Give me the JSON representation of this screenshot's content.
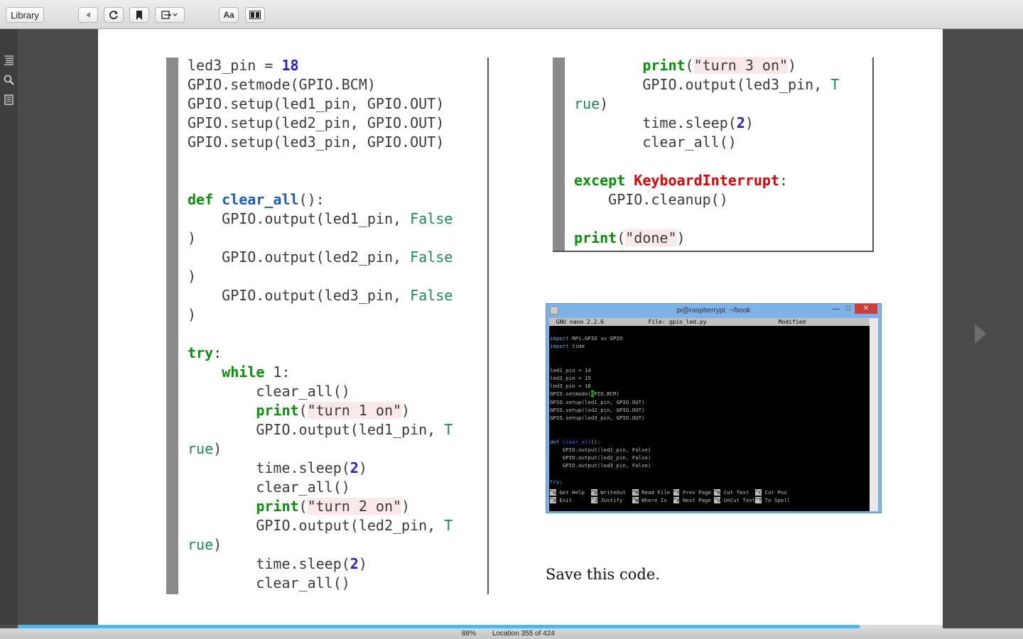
{
  "toolbar": {
    "library_label": "Library",
    "font_label": "Aa"
  },
  "left_code": [
    "led3_pin = 18",
    "GPIO.setmode(GPIO.BCM)",
    "GPIO.setup(led1_pin, GPIO.OUT)",
    "GPIO.setup(led2_pin, GPIO.OUT)",
    "GPIO.setup(led3_pin, GPIO.OUT)",
    "",
    "",
    "def clear_all():",
    "    GPIO.output(led1_pin, False",
    ")",
    "    GPIO.output(led2_pin, False",
    ")",
    "    GPIO.output(led3_pin, False",
    ")",
    "",
    "try:",
    "    while 1:",
    "        clear_all()",
    "        print(\"turn 1 on\")",
    "        GPIO.output(led1_pin, T",
    "rue)",
    "        time.sleep(2)",
    "        clear_all()",
    "        print(\"turn 2 on\")",
    "        GPIO.output(led2_pin, T",
    "rue)",
    "        time.sleep(2)",
    "        clear_all()"
  ],
  "right_code": [
    "        print(\"turn 3 on\")",
    "        GPIO.output(led3_pin, T",
    "rue)",
    "        time.sleep(2)",
    "        clear_all()",
    "",
    "except KeyboardInterrupt:",
    "    GPIO.cleanup()",
    "",
    "print(\"done\")"
  ],
  "terminal": {
    "title": "pi@raspberrypi: ~/book",
    "close_label": "✕",
    "header": "  GNU nano 2.2.6             File: gpio_led.py                     Modified",
    "lines": [
      "import RPi.GPIO as GPIO",
      "import time",
      "",
      "",
      "led1_pin = 14",
      "led2_pin = 15",
      "led3_pin = 18",
      "GPIO.setmode(GPIO.BCM)",
      "GPIO.setup(led1_pin, GPIO.OUT)",
      "GPIO.setup(led2_pin, GPIO.OUT)",
      "GPIO.setup(led3_pin, GPIO.OUT)",
      "",
      "",
      "def clear_all():",
      "    GPIO.output(led1_pin, False)",
      "    GPIO.output(led2_pin, False)",
      "    GPIO.output(led3_pin, False)",
      "",
      "try:"
    ],
    "footer": [
      [
        [
          "^G",
          "Get Help"
        ],
        [
          "^O",
          "WriteOut"
        ],
        [
          "^R",
          "Read File"
        ],
        [
          "^Y",
          "Prev Page"
        ],
        [
          "^K",
          "Cut Text"
        ],
        [
          "^C",
          "Cur Pos"
        ]
      ],
      [
        [
          "^X",
          "Exit"
        ],
        [
          "^J",
          "Justify"
        ],
        [
          "^W",
          "Where Is"
        ],
        [
          "^V",
          "Next Page"
        ],
        [
          "^U",
          "UnCut Text"
        ],
        [
          "^T",
          "To Spell"
        ]
      ]
    ]
  },
  "caption": "Save this code.",
  "status": {
    "percent": "88%",
    "location": "Location 355 of 424",
    "progress_fraction": 0.91
  },
  "colors": {
    "keyword": "#0a8f0a",
    "function": "#1a5fb4",
    "number": "#1f1fd4",
    "exception": "#e00000",
    "progress": "#5ab4e0"
  }
}
